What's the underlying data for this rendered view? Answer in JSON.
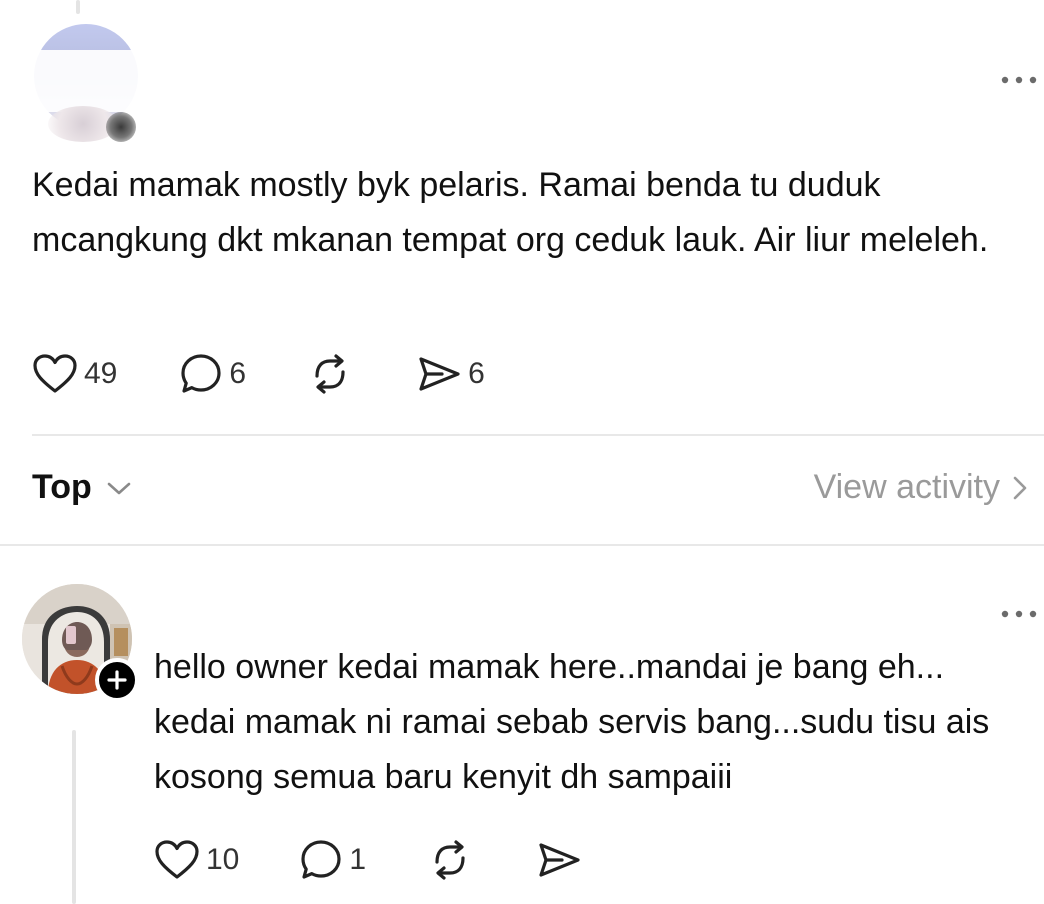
{
  "post": {
    "text": "Kedai mamak mostly byk pelaris. Ramai benda tu duduk mcangkung dkt mkanan tempat org ceduk lauk. Air liur meleleh.",
    "likes": "49",
    "replies": "6",
    "shares": "6",
    "icons": [
      "heart-icon",
      "comment-icon",
      "repost-icon",
      "share-icon",
      "more-icon"
    ]
  },
  "sort": {
    "label": "Top",
    "view_activity": "View activity"
  },
  "reply": {
    "text": "hello owner kedai mamak here..mandai je bang eh... kedai mamak ni ramai sebab servis bang...sudu tisu ais kosong semua baru kenyit dh sampaiii",
    "likes": "10",
    "replies": "1"
  },
  "colors": {
    "text": "#111111",
    "muted": "#9a9a9a",
    "divider": "#e8e8e8"
  }
}
